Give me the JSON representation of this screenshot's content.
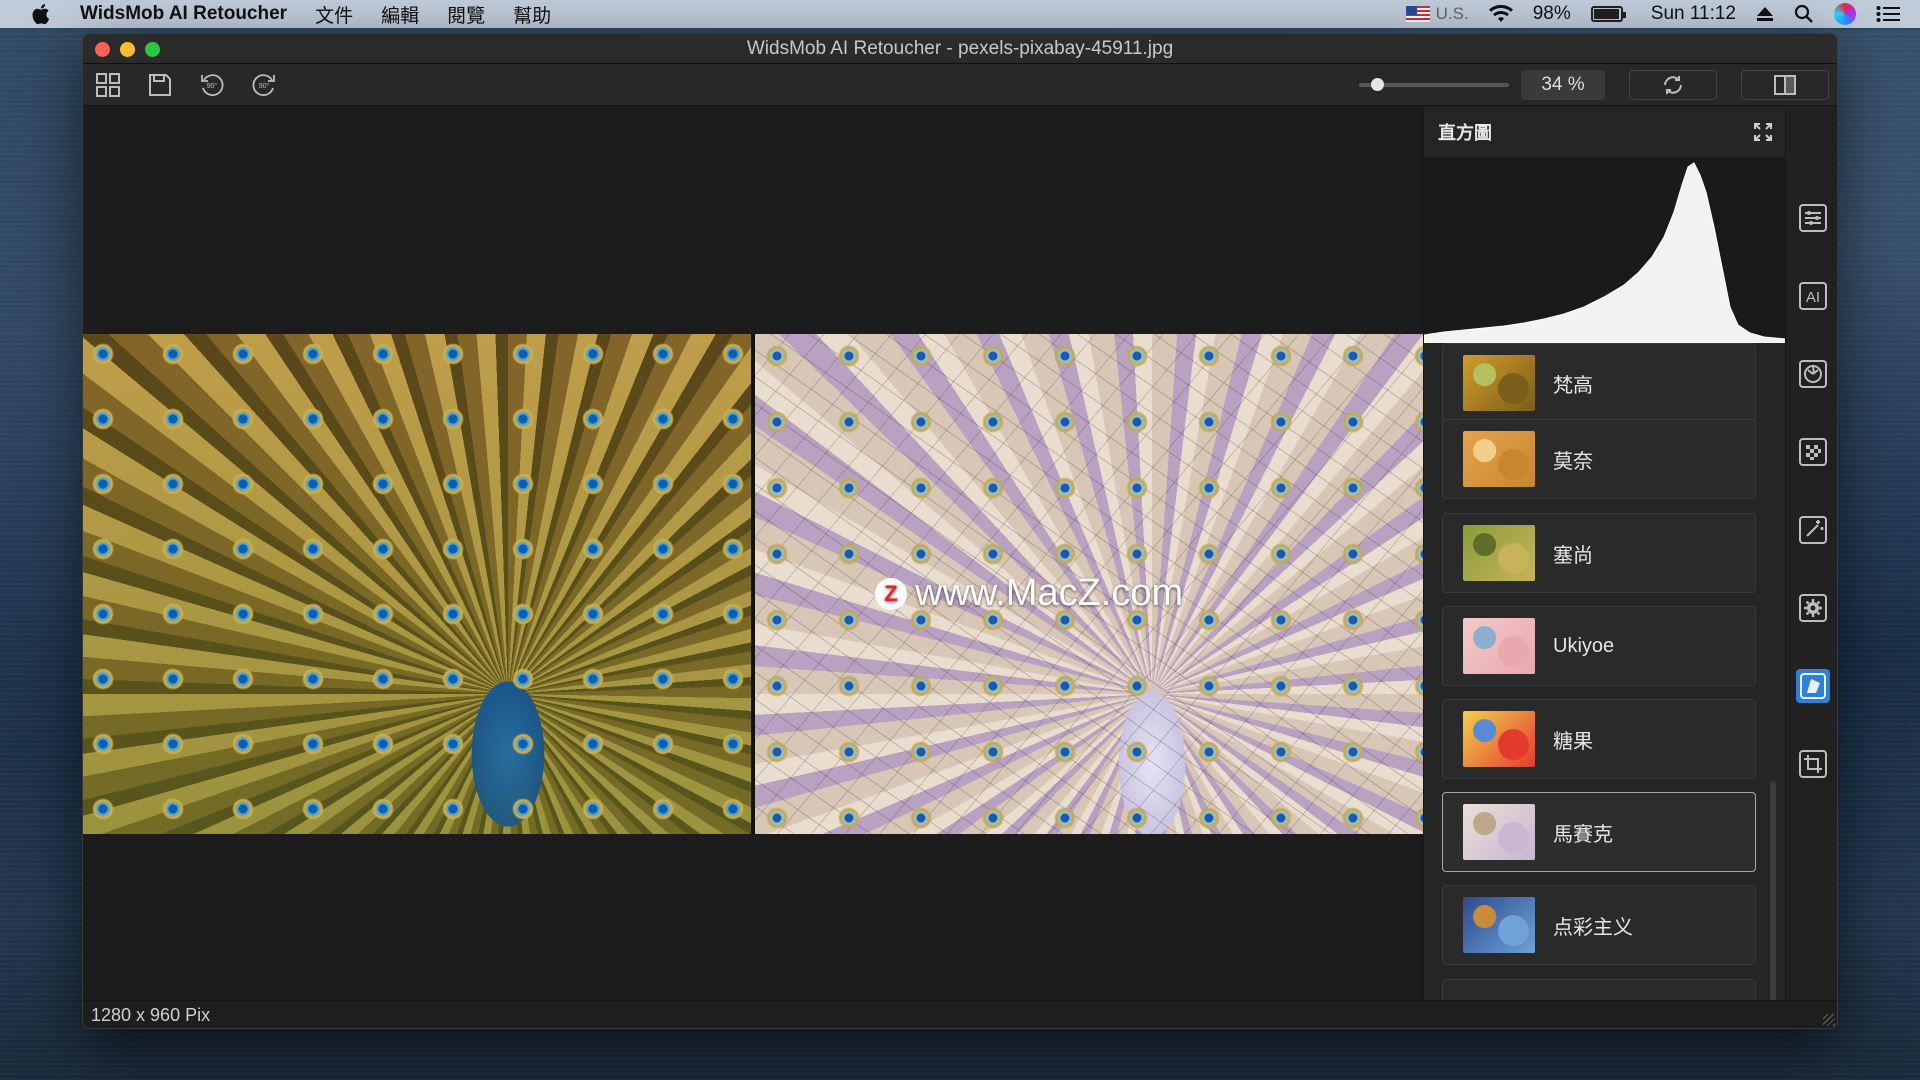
{
  "menubar": {
    "app_name": "WidsMob AI Retoucher",
    "menus": [
      "文件",
      "編輯",
      "閱覽",
      "幫助"
    ],
    "input_language": "U.S.",
    "battery_percent": "98%",
    "battery_level": 0.98,
    "clock": "Sun 11:12"
  },
  "window": {
    "title": "WidsMob AI Retoucher - pexels-pixabay-45911.jpg"
  },
  "toolbar": {
    "zoom_percent": 34,
    "zoom_label": "34 %",
    "icons": [
      "grid-icon",
      "save-icon",
      "rotate-left-90-icon",
      "rotate-right-90-icon",
      "reset-icon",
      "split-view-icon"
    ]
  },
  "canvas": {
    "watermark_text": "www.MacZ.com",
    "watermark_logo": "Z"
  },
  "panel": {
    "histogram_label": "直方圖",
    "filters": [
      {
        "name": "梵高",
        "colors": [
          "#d39a2a",
          "#7a5e1a",
          "#b5c060"
        ]
      },
      {
        "name": "莫奈",
        "colors": [
          "#e7a34e",
          "#c8862e",
          "#f0cf8c"
        ]
      },
      {
        "name": "塞尚",
        "colors": [
          "#8a9d3a",
          "#c7b35a",
          "#5e6e2a"
        ]
      },
      {
        "name": "Ukiyoe",
        "colors": [
          "#f2c9c9",
          "#e9a8b0",
          "#8bb0cf"
        ]
      },
      {
        "name": "糖果",
        "colors": [
          "#f2d24a",
          "#e23a2e",
          "#5a8ad6"
        ]
      },
      {
        "name": "馬賽克",
        "colors": [
          "#e9dfd6",
          "#c9b6d2",
          "#bfa58a"
        ],
        "selected": true
      },
      {
        "name": "点彩主义",
        "colors": [
          "#2e4a8c",
          "#6fa2d8",
          "#c98b3e"
        ]
      }
    ]
  },
  "sidebar_icons": [
    "adjustments-icon",
    "ai-icon",
    "lens-icon",
    "noise-icon",
    "magic-wand-icon",
    "settings-icon",
    "style-filter-icon",
    "crop-icon"
  ],
  "sidebar_active": "style-filter-icon",
  "status": {
    "dimensions": "1280 x 960 Pix"
  },
  "colors": {
    "accent": "#2f7fd4",
    "window_bg": "#1e1e1e"
  }
}
